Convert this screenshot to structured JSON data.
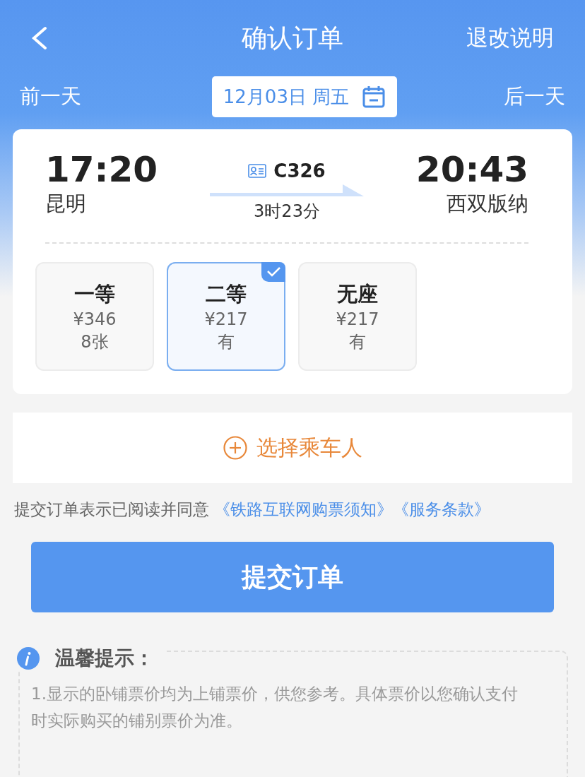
{
  "nav": {
    "title": "确认订单",
    "action": "退改说明"
  },
  "date_bar": {
    "prev": "前一天",
    "date": "12月03日 周五",
    "next": "后一天"
  },
  "train": {
    "depart_time": "17:20",
    "depart_station": "昆明",
    "number": "C326",
    "duration": "3时23分",
    "arrive_time": "20:43",
    "arrive_station": "西双版纳"
  },
  "seats": [
    {
      "name": "一等",
      "price": "¥346",
      "availability": "8张",
      "selected": false
    },
    {
      "name": "二等",
      "price": "¥217",
      "availability": "有",
      "selected": true
    },
    {
      "name": "无座",
      "price": "¥217",
      "availability": "有",
      "selected": false
    }
  ],
  "passenger": {
    "label": "选择乘车人"
  },
  "agreement": {
    "text": "提交订单表示已阅读并同意",
    "links": [
      "《铁路互联网购票须知》",
      "《服务条款》"
    ]
  },
  "submit": "提交订单",
  "tips": {
    "title": "温馨提示：",
    "items": [
      "1.显示的卧铺票价均为上铺票价，供您参考。具体票价以您确认支付时实际购买的铺别票价为准。"
    ]
  }
}
